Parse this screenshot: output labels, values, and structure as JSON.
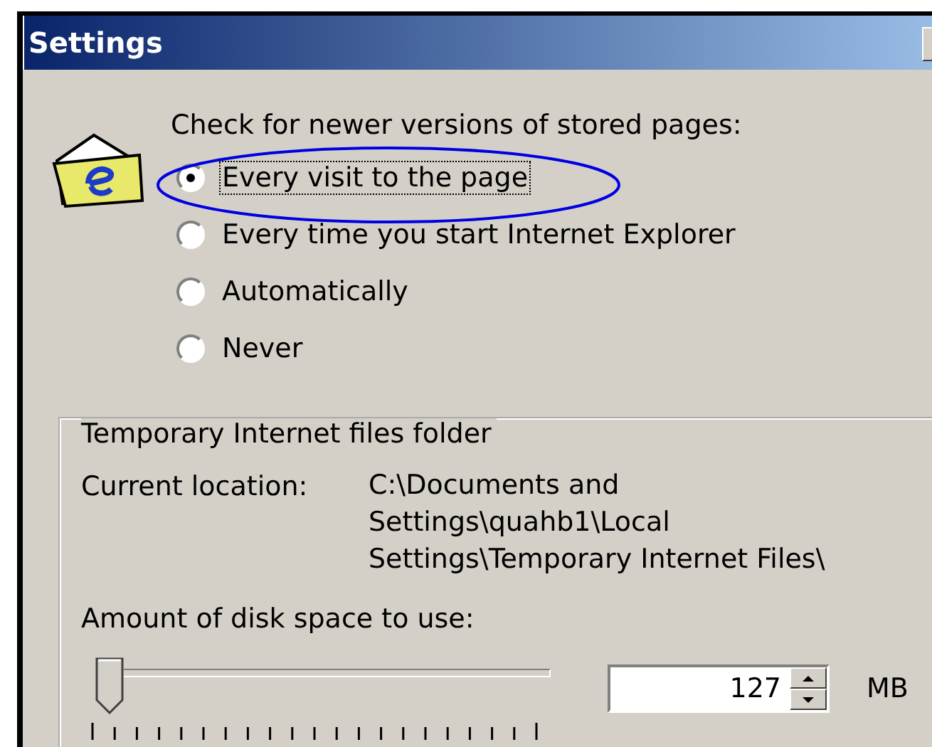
{
  "window": {
    "title": "Settings"
  },
  "check_label": "Check for newer versions of stored pages:",
  "options": [
    {
      "label": "Every visit to the page",
      "selected": true
    },
    {
      "label": "Every time you start Internet Explorer",
      "selected": false
    },
    {
      "label": "Automatically",
      "selected": false
    },
    {
      "label": "Never",
      "selected": false
    }
  ],
  "folder_group": {
    "title": "Temporary Internet files folder",
    "location_label": "Current location:",
    "location_lines": [
      "C:\\Documents and",
      "Settings\\quahb1\\Local",
      "Settings\\Temporary Internet Files\\"
    ],
    "disk_label": "Amount of disk space to use:",
    "disk_slider": {
      "level": 0
    },
    "disk_value": "127",
    "unit": "MB"
  }
}
